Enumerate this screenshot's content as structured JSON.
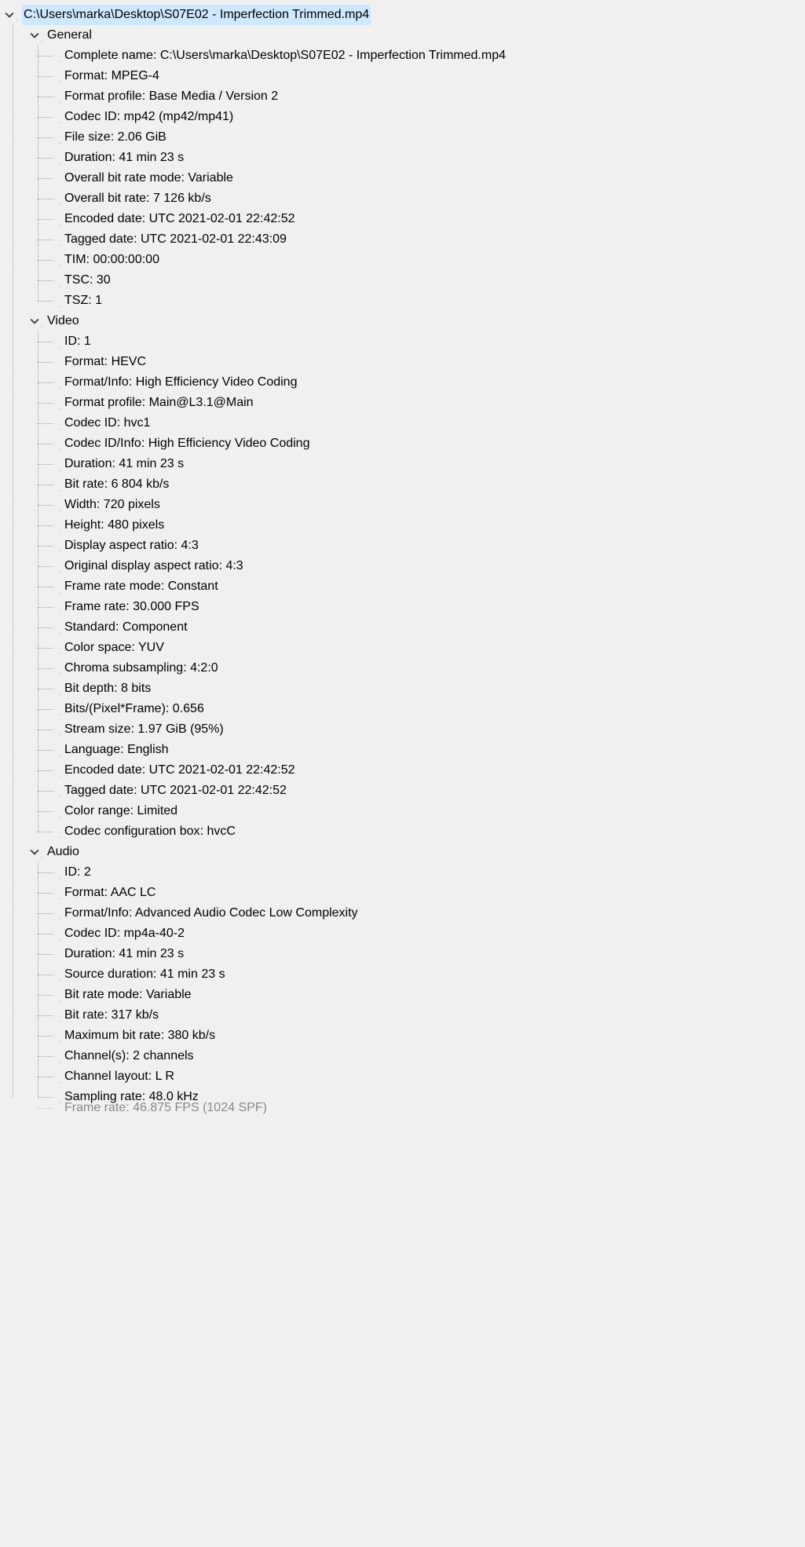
{
  "root": {
    "path": "C:\\Users\\marka\\Desktop\\S07E02 - Imperfection Trimmed.mp4"
  },
  "sections": [
    {
      "name": "General",
      "items": [
        {
          "k": "Complete name",
          "v": "C:\\Users\\marka\\Desktop\\S07E02 - Imperfection Trimmed.mp4"
        },
        {
          "k": "Format",
          "v": "MPEG-4"
        },
        {
          "k": "Format profile",
          "v": "Base Media / Version 2"
        },
        {
          "k": "Codec ID",
          "v": "mp42 (mp42/mp41)"
        },
        {
          "k": "File size",
          "v": "2.06 GiB"
        },
        {
          "k": "Duration",
          "v": "41 min 23 s"
        },
        {
          "k": "Overall bit rate mode",
          "v": "Variable"
        },
        {
          "k": "Overall bit rate",
          "v": "7 126 kb/s"
        },
        {
          "k": "Encoded date",
          "v": "UTC 2021-02-01 22:42:52"
        },
        {
          "k": "Tagged date",
          "v": "UTC 2021-02-01 22:43:09"
        },
        {
          "k": "TIM",
          "v": "00:00:00:00"
        },
        {
          "k": "TSC",
          "v": "30"
        },
        {
          "k": "TSZ",
          "v": "1"
        }
      ]
    },
    {
      "name": "Video",
      "items": [
        {
          "k": "ID",
          "v": "1"
        },
        {
          "k": "Format",
          "v": "HEVC"
        },
        {
          "k": "Format/Info",
          "v": "High Efficiency Video Coding"
        },
        {
          "k": "Format profile",
          "v": "Main@L3.1@Main"
        },
        {
          "k": "Codec ID",
          "v": "hvc1"
        },
        {
          "k": "Codec ID/Info",
          "v": "High Efficiency Video Coding"
        },
        {
          "k": "Duration",
          "v": "41 min 23 s"
        },
        {
          "k": "Bit rate",
          "v": "6 804 kb/s"
        },
        {
          "k": "Width",
          "v": "720 pixels"
        },
        {
          "k": "Height",
          "v": "480 pixels"
        },
        {
          "k": "Display aspect ratio",
          "v": "4:3"
        },
        {
          "k": "Original display aspect ratio",
          "v": "4:3"
        },
        {
          "k": "Frame rate mode",
          "v": "Constant"
        },
        {
          "k": "Frame rate",
          "v": "30.000 FPS"
        },
        {
          "k": "Standard",
          "v": "Component"
        },
        {
          "k": "Color space",
          "v": "YUV"
        },
        {
          "k": "Chroma subsampling",
          "v": "4:2:0"
        },
        {
          "k": "Bit depth",
          "v": "8 bits"
        },
        {
          "k": "Bits/(Pixel*Frame)",
          "v": "0.656"
        },
        {
          "k": "Stream size",
          "v": "1.97 GiB (95%)"
        },
        {
          "k": "Language",
          "v": "English"
        },
        {
          "k": "Encoded date",
          "v": "UTC 2021-02-01 22:42:52"
        },
        {
          "k": "Tagged date",
          "v": "UTC 2021-02-01 22:42:52"
        },
        {
          "k": "Color range",
          "v": "Limited"
        },
        {
          "k": "Codec configuration box",
          "v": "hvcC"
        }
      ]
    },
    {
      "name": "Audio",
      "items": [
        {
          "k": "ID",
          "v": "2"
        },
        {
          "k": "Format",
          "v": "AAC LC"
        },
        {
          "k": "Format/Info",
          "v": "Advanced Audio Codec Low Complexity"
        },
        {
          "k": "Codec ID",
          "v": "mp4a-40-2"
        },
        {
          "k": "Duration",
          "v": "41 min 23 s"
        },
        {
          "k": "Source duration",
          "v": "41 min 23 s"
        },
        {
          "k": "Bit rate mode",
          "v": "Variable"
        },
        {
          "k": "Bit rate",
          "v": "317 kb/s"
        },
        {
          "k": "Maximum bit rate",
          "v": "380 kb/s"
        },
        {
          "k": "Channel(s)",
          "v": "2 channels"
        },
        {
          "k": "Channel layout",
          "v": "L R"
        },
        {
          "k": "Sampling rate",
          "v": "48.0 kHz"
        }
      ]
    }
  ],
  "partial_row": "Frame rate: 46.875 FPS (1024 SPF)"
}
